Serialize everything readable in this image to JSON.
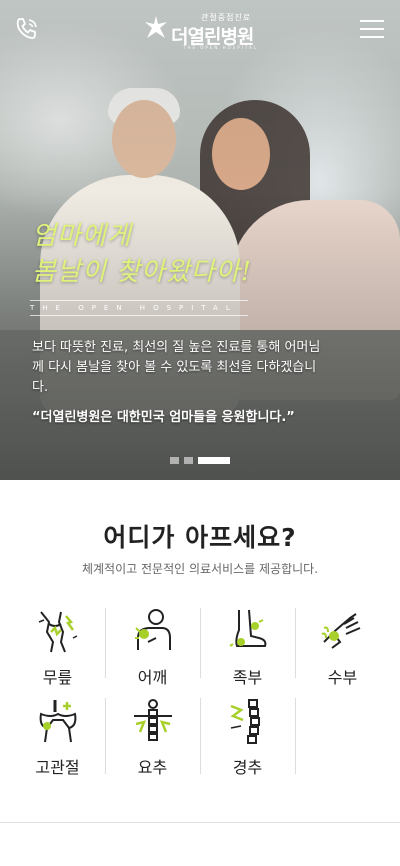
{
  "header": {
    "logo_sub": "관절중점진료",
    "logo_name": "더열린병원",
    "logo_en": "THE OPEN HOSPITAL",
    "phone_icon": "phone-icon",
    "menu_icon": "hamburger-icon"
  },
  "hero": {
    "script_line1": "엄마에게",
    "script_line2": "봄날이 찾아왔다아!",
    "tagline": "THE OPEN HOSPITAL",
    "body": "보다 따뜻한 진료, 최선의 질 높은 진료를 통해 어머님께 다시 봄날을 찾아 볼 수 있도록 최선을 다하겠습니다.",
    "quote": "“더열린병원은 대한민국 엄마들을 응원합니다.”",
    "slides_total": 3,
    "slide_active": 3,
    "accent_color": "#dff27a"
  },
  "section": {
    "title": "어디가 아프세요?",
    "subtitle": "체계적이고 전문적인 의료서비스를 제공합니다."
  },
  "categories": [
    {
      "label": "무릎",
      "icon": "knee-icon"
    },
    {
      "label": "어깨",
      "icon": "shoulder-icon"
    },
    {
      "label": "족부",
      "icon": "foot-icon"
    },
    {
      "label": "수부",
      "icon": "hand-icon"
    },
    {
      "label": "고관절",
      "icon": "hip-joint-icon"
    },
    {
      "label": "요추",
      "icon": "lumbar-spine-icon"
    },
    {
      "label": "경추",
      "icon": "cervical-spine-icon"
    }
  ],
  "colors": {
    "icon_accent": "#a8d02a",
    "icon_line": "#222222"
  }
}
